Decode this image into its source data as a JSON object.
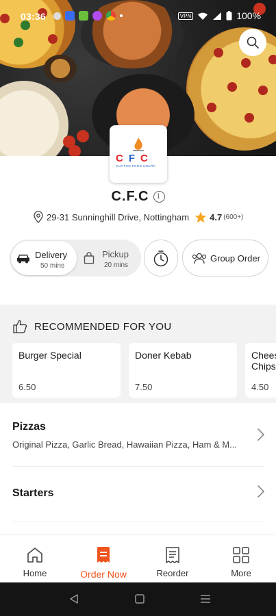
{
  "status_bar": {
    "time": "03:36",
    "vpn_label": "VPN",
    "battery": "100%"
  },
  "restaurant": {
    "name": "C.F.C",
    "logo_letters": "CFC",
    "logo_subtitle": "CLIFTON  FOOD  COURT",
    "address": "29-31 Sunninghill Drive, Nottingham",
    "rating": "4.7",
    "rating_count": "(600+)"
  },
  "order_mode": {
    "delivery_label": "Delivery",
    "delivery_time": "50 mins",
    "pickup_label": "Pickup",
    "pickup_time": "20 mins",
    "group_order_label": "Group Order"
  },
  "recommended": {
    "heading": "RECOMMENDED FOR YOU",
    "items": [
      {
        "name": "Burger Special",
        "price": "6.50"
      },
      {
        "name": "Doner Kebab",
        "price": "7.50"
      },
      {
        "name": "Chee Chips",
        "name_line1": "Chees",
        "name_line2": "Chips",
        "price": "4.50"
      }
    ]
  },
  "categories": [
    {
      "title": "Pizzas",
      "subtitle": "Original Pizza, Garlic Bread, Hawaiian Pizza, Ham & M..."
    },
    {
      "title": "Starters",
      "subtitle": ""
    }
  ],
  "bottom_nav": {
    "items": [
      {
        "label": "Home",
        "icon": "home-icon"
      },
      {
        "label": "Order Now",
        "icon": "order-icon"
      },
      {
        "label": "Reorder",
        "icon": "receipt-icon"
      },
      {
        "label": "More",
        "icon": "grid-icon"
      }
    ],
    "active_index": 1
  },
  "colors": {
    "accent": "#f1551f",
    "star": "#f5a623",
    "logo_red": "#e8222a",
    "logo_blue": "#2a64c8"
  }
}
